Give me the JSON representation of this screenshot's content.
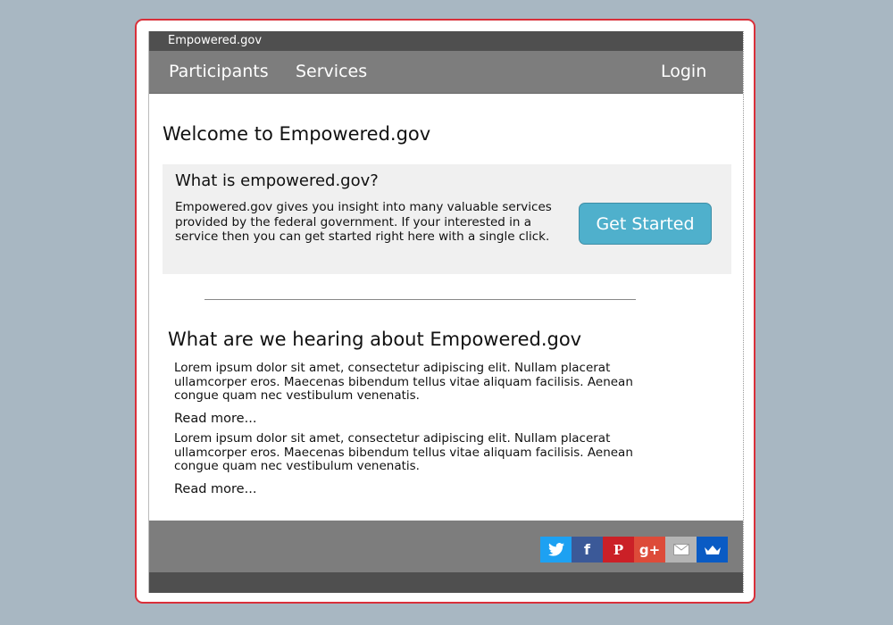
{
  "site": {
    "brand": "Empowered.gov"
  },
  "nav": {
    "participants": "Participants",
    "services": "Services",
    "login": "Login"
  },
  "main": {
    "welcome_title": "Welcome to Empowered.gov",
    "info": {
      "question": "What is empowered.gov?",
      "description": "Empowered.gov gives you insight into many valuable services provided by the federal government. If your interested in a service then you can get started right here with a single click.",
      "button": "Get Started"
    },
    "hearing": {
      "title": "What are we hearing about Empowered.gov",
      "items": [
        {
          "text": "Lorem ipsum dolor sit amet, consectetur adipiscing elit. Nullam placerat ullamcorper eros. Maecenas bibendum tellus vitae aliquam facilisis. Aenean congue quam nec vestibulum venenatis.",
          "read_more": "Read more..."
        },
        {
          "text": "Lorem ipsum dolor sit amet, consectetur adipiscing elit. Nullam placerat ullamcorper eros. Maecenas bibendum tellus vitae aliquam facilisis. Aenean congue quam nec vestibulum venenatis.",
          "read_more": "Read more..."
        }
      ]
    }
  },
  "footer": {
    "social": [
      {
        "name": "twitter-icon",
        "color": "#1da1f2"
      },
      {
        "name": "facebook-icon",
        "glyph": "f",
        "color": "#3b5998"
      },
      {
        "name": "pinterest-icon",
        "glyph": "P",
        "color": "#cb2027"
      },
      {
        "name": "google-plus-icon",
        "glyph": "g+",
        "color": "#dd4b39"
      },
      {
        "name": "email-icon",
        "color": "#b4b4b4"
      },
      {
        "name": "crown-icon",
        "color": "#0a5bc4"
      }
    ]
  }
}
